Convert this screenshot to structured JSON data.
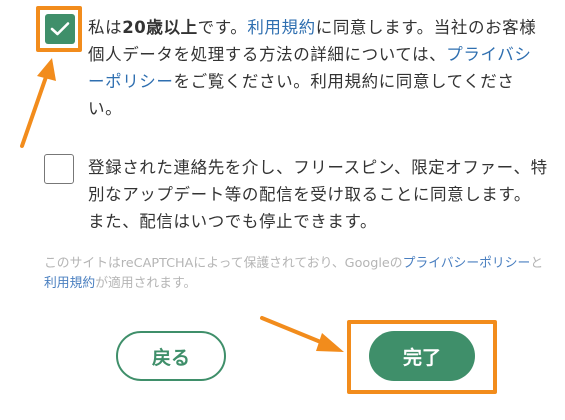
{
  "consent_age_terms": {
    "checked": true,
    "text_prefix": "私は",
    "text_bold": "20歳以上",
    "text_after_bold": "です。",
    "terms_link": "利用規約",
    "text_middle": "に同意します。当社のお客様個人データを処理する方法の詳細については、",
    "privacy_link": "プライバシーポリシー",
    "text_suffix": "をご覧ください。利用規約に同意してください。"
  },
  "consent_marketing": {
    "checked": false,
    "text": "登録された連絡先を介し、フリースピン、限定オファー、特別なアップデート等の配信を受け取ることに同意します。また、配信はいつでも停止できます。"
  },
  "recaptcha_notice": {
    "prefix": "このサイトはreCAPTCHAによって保護されており、Googleの",
    "privacy_link": "プライバシーポリシー",
    "connector": "と",
    "terms_link": "利用規約",
    "suffix": "が適用されます。"
  },
  "buttons": {
    "back_label": "戻る",
    "done_label": "完了"
  },
  "colors": {
    "accent_green": "#3f8f6a",
    "highlight_orange": "#f28c1c",
    "link_blue": "#2f6fb0"
  },
  "icons": {
    "checkbox_checked": "check-icon"
  }
}
